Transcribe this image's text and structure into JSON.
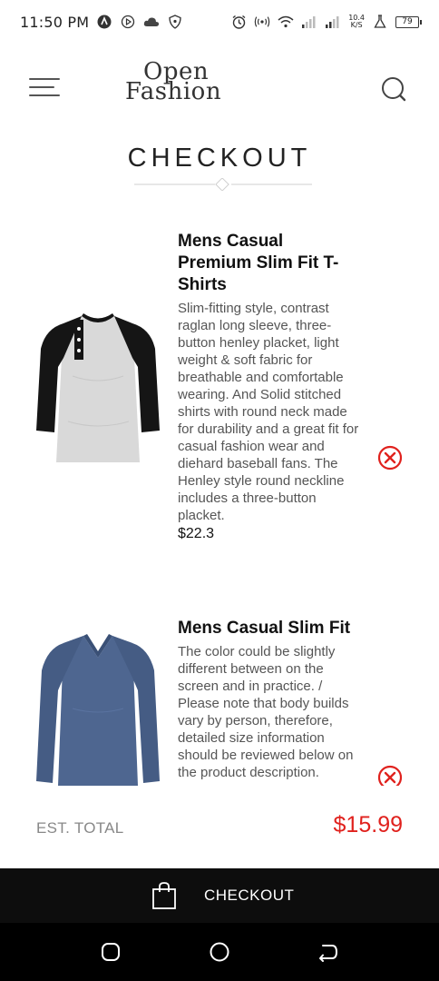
{
  "status_bar": {
    "time": "11:50 PM",
    "net_speed_value": "10.4",
    "net_speed_unit": "K/S",
    "battery": "79"
  },
  "header": {
    "logo_line1": "Open",
    "logo_line2": "Fashion"
  },
  "page": {
    "title": "CHECKOUT"
  },
  "cart": {
    "items": [
      {
        "name": "Mens Casual Premium Slim Fit T-Shirts",
        "description": "Slim-fitting style, contrast raglan long sleeve, three-button henley placket, light weight & soft fabric for breathable and comfortable wearing. And Solid stitched shirts with round neck made for durability and a great fit for casual fashion wear and diehard baseball fans. The Henley style round neckline includes a three-button placket.",
        "price": "$22.3",
        "icon": "raglan-henley-shirt"
      },
      {
        "name": "Mens Casual Slim Fit",
        "description": "The color could be slightly different between on the screen and in practice. / Please note that body builds vary by person, therefore, detailed size information should be reviewed below on the product description.",
        "icon": "blue-long-sleeve-shirt"
      }
    ]
  },
  "total": {
    "label": "EST. TOTAL",
    "value": "$15.99"
  },
  "checkout": {
    "label": "CHECKOUT"
  },
  "colors": {
    "accent_red": "#e0211d",
    "checkout_bar": "#0d0d0d",
    "nav_bar": "#000000"
  }
}
